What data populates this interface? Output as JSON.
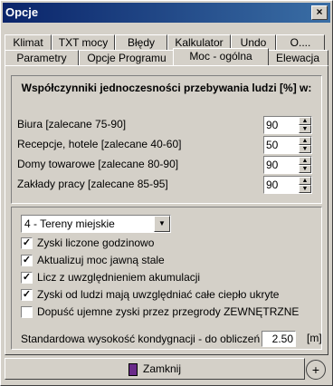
{
  "window": {
    "title": "Opcje",
    "close_glyph": "×"
  },
  "tabs_row1": [
    "Klimat",
    "TXT mocy",
    "Błędy",
    "Kalkulator",
    "Undo",
    "O...."
  ],
  "tabs_row2": [
    "Parametry",
    "Opcje Programu",
    "Moc - ogólna",
    "Elewacja"
  ],
  "active_tab": "Moc - ogólna",
  "group1": {
    "heading": "Współczynniki jednoczesności przebywania ludzi [%] w:",
    "rows": [
      {
        "label": "Biura [zalecane 75-90]",
        "value": "90"
      },
      {
        "label": "Recepcje, hotele [zalecane 40-60]",
        "value": "50"
      },
      {
        "label": "Domy towarowe [zalecane 80-90]",
        "value": "90"
      },
      {
        "label": "Zakłady pracy [zalecane 85-95]",
        "value": "90"
      }
    ]
  },
  "group2": {
    "combo_value": "4 - Tereny miejskie",
    "checkboxes": [
      {
        "label": "Zyski liczone godzinowo",
        "checked": "✓"
      },
      {
        "label": "Aktualizuj moc jawną stale",
        "checked": "✓"
      },
      {
        "label": "Licz z uwzględnieniem akumulacji",
        "checked": "✓"
      },
      {
        "label": "Zyski od ludzi mają uwzględniać całe ciepło ukryte",
        "checked": "✓"
      },
      {
        "label": "Dopuść ujemne zyski przez przegrody ZEWNĘTRZNE",
        "checked": ""
      }
    ],
    "std_label": "Standardowa wysokość kondygnacji - do obliczeń strat",
    "std_value": "2.50",
    "std_unit": "[m]"
  },
  "footer": {
    "close_label": "Zamknij",
    "plus_glyph": "+"
  }
}
